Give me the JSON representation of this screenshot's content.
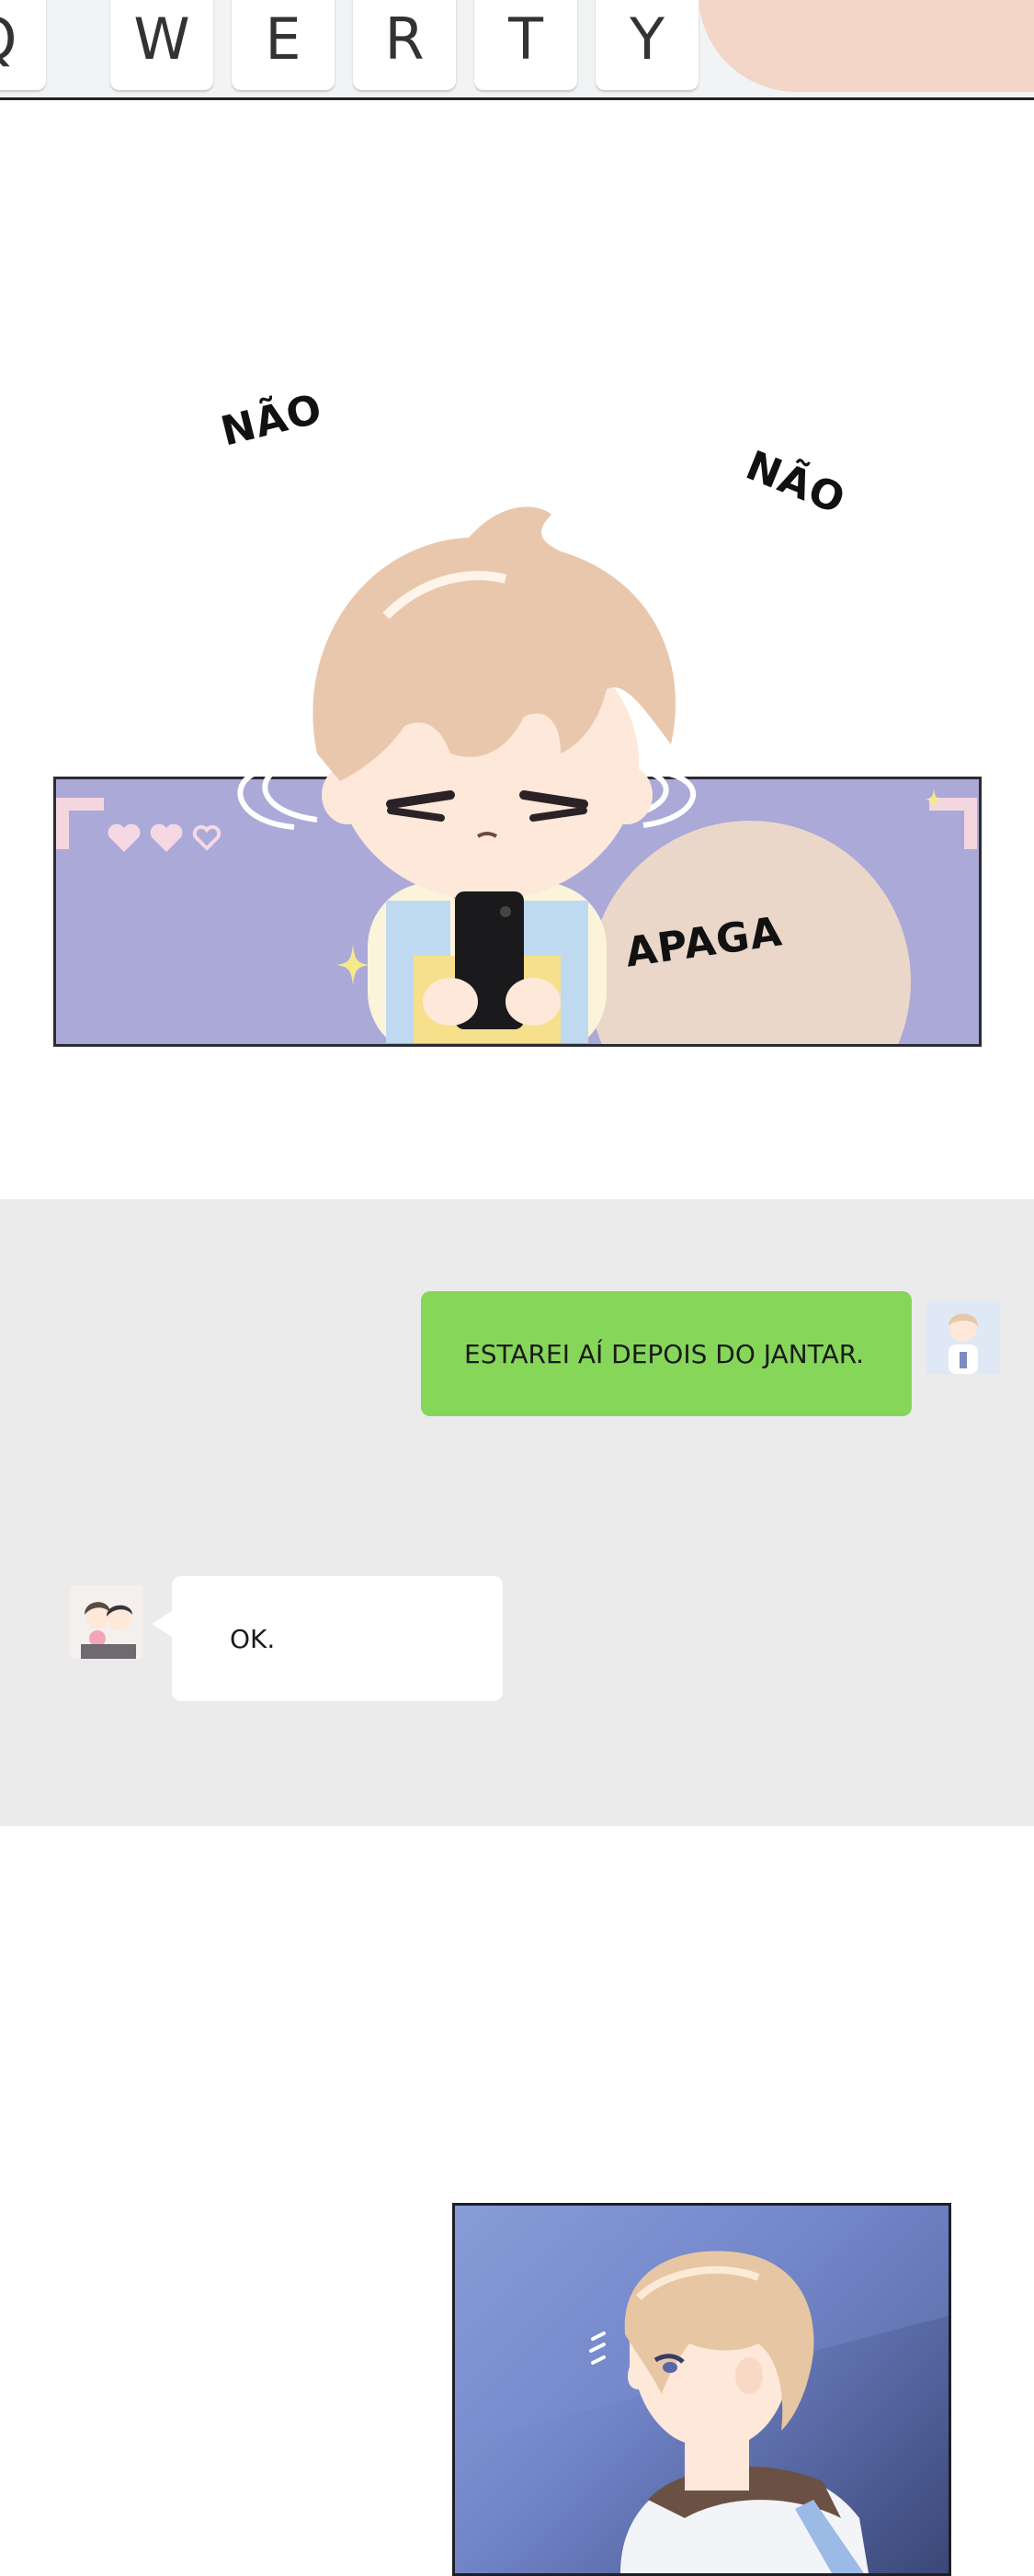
{
  "keyboard": {
    "keys": [
      "Q",
      "W",
      "E",
      "R",
      "T",
      "Y"
    ]
  },
  "panel_chibi": {
    "sfx_left": "NÃO",
    "sfx_right": "NÃO",
    "sfx_delete": "APAGA"
  },
  "chat": {
    "background_color": "#ebebeb",
    "bubble_color_sent": "#86d65a",
    "bubble_color_received": "#ffffff",
    "messages": [
      {
        "side": "right",
        "text": "ESTAREI AÍ DEPOIS DO JANTAR."
      },
      {
        "side": "left",
        "text": "OK."
      }
    ]
  }
}
